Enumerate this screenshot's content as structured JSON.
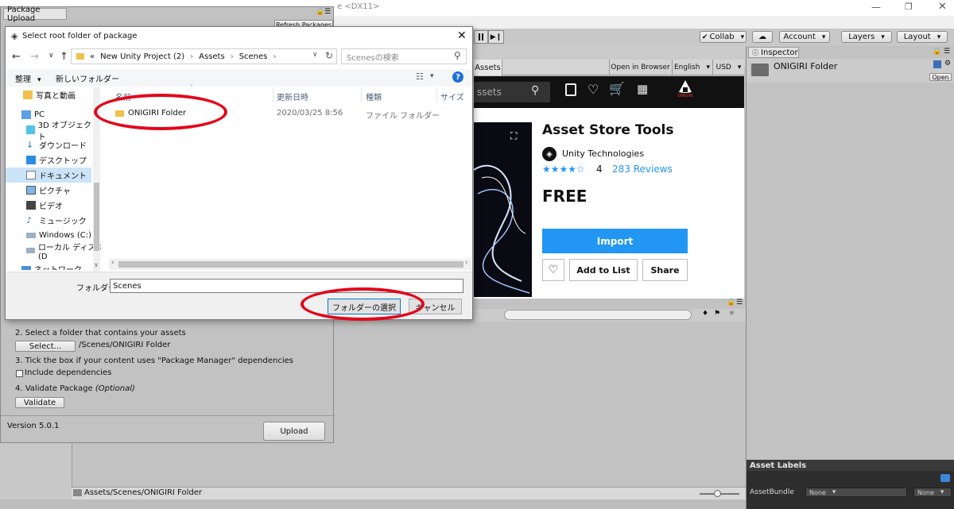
{
  "title_suffix": "e <DX11>",
  "toolbar": {
    "collab": "Collab",
    "account": "Account",
    "layers": "Layers",
    "layout": "Layout"
  },
  "package_upload": {
    "tab": "Package Upload",
    "refresh": "Refresh Packages",
    "step2": "2. Select a folder that contains your assets",
    "select_btn": "Select...",
    "path": "/Scenes/ONIGIRI Folder",
    "step3": "3. Tick the box if your content uses \"Package Manager\" dependencies",
    "include": "Include dependencies",
    "step4": "4. Validate Package ",
    "optional": "(Optional)",
    "validate": "Validate",
    "version": "Version 5.0.1",
    "upload": "Upload"
  },
  "dialog": {
    "title": "Select root folder of package",
    "breadcrumb": [
      "«",
      "New Unity Project (2)",
      "Assets",
      "Scenes"
    ],
    "search_placeholder": "Scenesの検索",
    "organize": "整理",
    "new_folder": "新しいフォルダー",
    "columns": [
      "名前",
      "更新日時",
      "種類",
      "サイズ"
    ],
    "nav": [
      {
        "label": "写真と動画",
        "icon": "folder-icon"
      },
      {
        "label": "PC",
        "icon": "pc-icon"
      },
      {
        "label": "3D オブジェクト",
        "icon": "cube-icon"
      },
      {
        "label": "ダウンロード",
        "icon": "download-icon"
      },
      {
        "label": "デスクトップ",
        "icon": "desktop-icon"
      },
      {
        "label": "ドキュメント",
        "icon": "document-icon"
      },
      {
        "label": "ピクチャ",
        "icon": "picture-icon"
      },
      {
        "label": "ビデオ",
        "icon": "video-icon"
      },
      {
        "label": "ミュージック",
        "icon": "music-icon"
      },
      {
        "label": "Windows (C:)",
        "icon": "drive-icon"
      },
      {
        "label": "ローカル ディスク (D",
        "icon": "drive-icon"
      },
      {
        "label": "ネットワーク",
        "icon": "network-icon"
      }
    ],
    "file": {
      "name": "ONIGIRI Folder",
      "date": "2020/03/25 8:56",
      "type": "ファイル フォルダー"
    },
    "folder_label": "フォルダー:",
    "folder_value": "Scenes",
    "select_folder": "フォルダーの選択",
    "cancel": "キャンセル"
  },
  "asset_store": {
    "tab": "Assets",
    "open_browser": "Open in Browser",
    "language": "English",
    "currency": "USD",
    "search_text": "ssets",
    "logo_text": "ONIGIRI",
    "product": "Asset Store Tools",
    "publisher": "Unity Technologies",
    "rating": 4,
    "rating_text": "4",
    "reviews": "283 Reviews",
    "price": "FREE",
    "import": "Import",
    "add_to_list": "Add to List",
    "share": "Share"
  },
  "inspector": {
    "tab": "Inspector",
    "item": "ONIGIRI Folder",
    "open": "Open"
  },
  "asset_labels": {
    "title": "Asset Labels",
    "bundle": "AssetBundle",
    "none1": "None",
    "none2": "None"
  },
  "project_path": "Assets/Scenes/ONIGIRI Folder",
  "colors": {
    "accent_blue": "#2196f3",
    "highlight_red": "#e3061b"
  }
}
